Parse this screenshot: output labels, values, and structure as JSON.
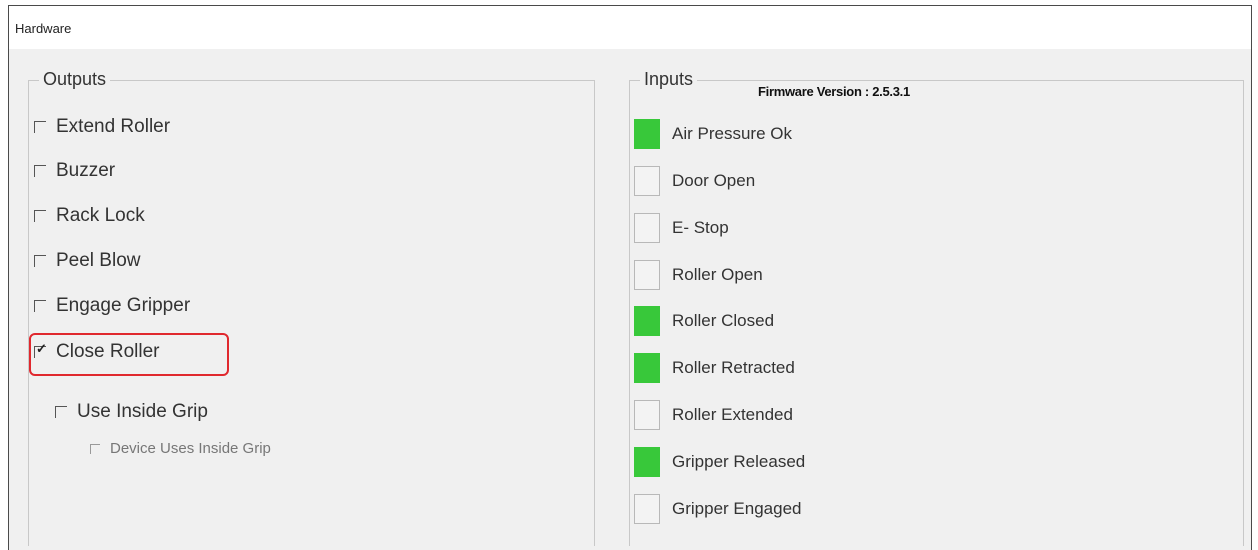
{
  "window": {
    "title": "Hardware"
  },
  "outputs": {
    "legend": "Outputs",
    "items": [
      {
        "label": "Extend Roller",
        "checked": false
      },
      {
        "label": "Buzzer",
        "checked": false
      },
      {
        "label": "Rack Lock",
        "checked": false
      },
      {
        "label": "Peel Blow",
        "checked": false
      },
      {
        "label": "Engage Gripper",
        "checked": false
      },
      {
        "label": "Close Roller",
        "checked": true
      }
    ],
    "use_inside_grip": {
      "label": "Use Inside Grip",
      "checked": false
    },
    "device_uses_inside_grip": {
      "label": "Device Uses Inside Grip",
      "checked": false,
      "enabled": false
    }
  },
  "inputs": {
    "legend": "Inputs",
    "firmware": "Firmware Version : 2.5.3.1",
    "items": [
      {
        "label": "Air Pressure Ok",
        "active": true
      },
      {
        "label": "Door Open",
        "active": false
      },
      {
        "label": "E- Stop",
        "active": false
      },
      {
        "label": "Roller Open",
        "active": false
      },
      {
        "label": "Roller Closed",
        "active": true
      },
      {
        "label": "Roller Retracted",
        "active": true
      },
      {
        "label": "Roller Extended",
        "active": false
      },
      {
        "label": "Gripper Released",
        "active": true
      },
      {
        "label": "Gripper Engaged",
        "active": false
      }
    ]
  },
  "colors": {
    "active_indicator": "#38c83a",
    "highlight_border": "#e0282e"
  }
}
